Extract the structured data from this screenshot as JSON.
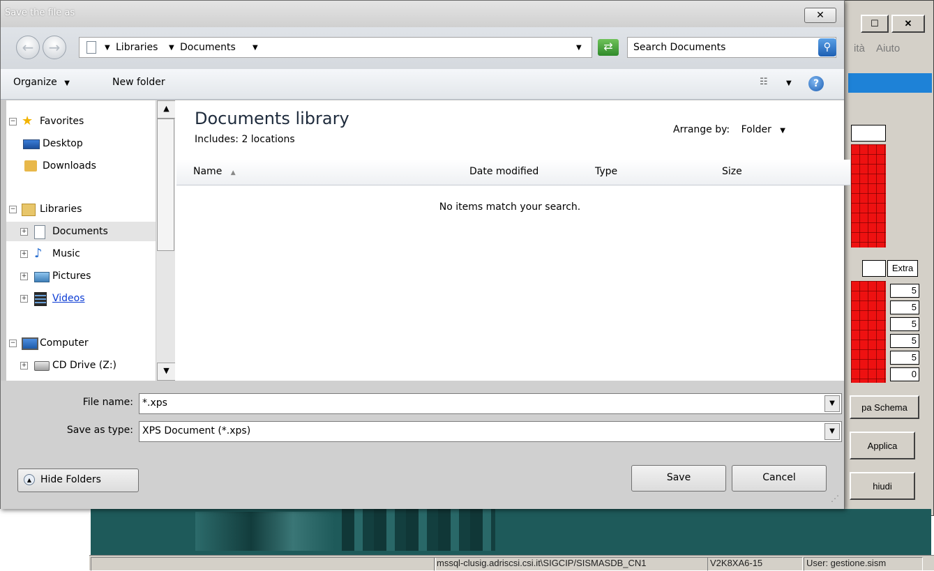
{
  "dialog": {
    "title": "Save the file as",
    "close_glyph": "✕",
    "breadcrumb": [
      {
        "label": "Libraries"
      },
      {
        "label": "Documents"
      }
    ],
    "search_placeholder": "Search Documents",
    "toolbar": {
      "organize": "Organize",
      "new_folder": "New folder"
    },
    "nav": {
      "items": [
        {
          "label": "Favorites",
          "icon": "star-icon",
          "level": 0,
          "expander": "⊟"
        },
        {
          "label": "Desktop",
          "icon": "desktop-icon",
          "level": 1
        },
        {
          "label": "Downloads",
          "icon": "downloads-folder-icon",
          "level": 1
        },
        {
          "label": "Libraries",
          "icon": "libraries-icon",
          "level": 0,
          "expander": "⊟"
        },
        {
          "label": "Documents",
          "icon": "document-icon",
          "level": 1,
          "expander": "⊞",
          "selected": true
        },
        {
          "label": "Music",
          "icon": "music-note-icon",
          "level": 1,
          "expander": "⊞"
        },
        {
          "label": "Pictures",
          "icon": "pictures-icon",
          "level": 1,
          "expander": "⊞"
        },
        {
          "label": "Videos",
          "icon": "videos-icon",
          "level": 1,
          "expander": "⊞",
          "link": true
        },
        {
          "label": "Computer",
          "icon": "computer-icon",
          "level": 0,
          "expander": "⊟"
        },
        {
          "label": "CD Drive (Z:)",
          "icon": "cd-drive-icon",
          "level": 1,
          "expander": "⊞"
        }
      ]
    },
    "library": {
      "title": "Documents library",
      "includes": "Includes:",
      "locations_link": "2 locations",
      "arrange_by_label": "Arrange by:",
      "arrange_by_value": "Folder",
      "columns": [
        "Name",
        "Date modified",
        "Type",
        "Size"
      ],
      "empty_message": "No items match your search."
    },
    "file_name_label": "File name:",
    "file_name_value": "*.xps",
    "save_type_label": "Save as type:",
    "save_type_value": "XPS Document (*.xps)",
    "hide_folders": "Hide Folders",
    "save": "Save",
    "cancel": "Cancel"
  },
  "background_app": {
    "title_buttons": [
      "☐",
      "✕"
    ],
    "menu": [
      "ità",
      "Aiuto"
    ],
    "extra_label": "Extra",
    "extra_values": [
      "5",
      "5",
      "5",
      "5",
      "5",
      "0"
    ],
    "mappa_button": "pa Schema",
    "applica_button": "Applica",
    "chiudi_button": "hiudi",
    "status_bar": {
      "server": "mssql-clusig.adriscsi.csi.it\\SIGCIP/SISMASDB_CN1",
      "machine": "V2K8XA6-15",
      "user": "User: gestione.sism"
    }
  },
  "colors": {
    "accent_blue": "#1e82d7",
    "bg_app_red": "#ee1111",
    "teal_strip": "#1e5a5a"
  }
}
